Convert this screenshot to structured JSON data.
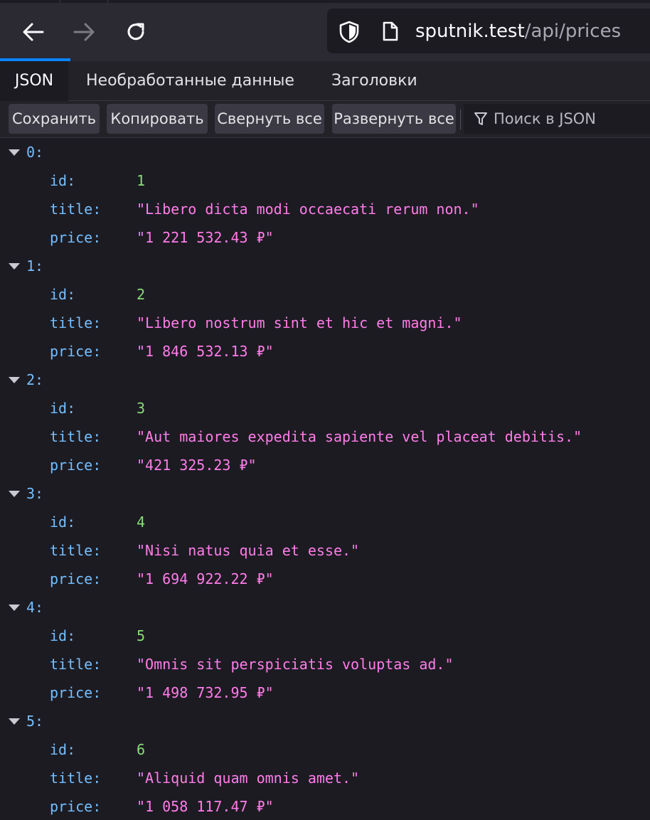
{
  "browser": {
    "url_host": "sputnik.test",
    "url_path": "/api/prices"
  },
  "viewer_tabs": [
    {
      "label": "JSON",
      "active": true
    },
    {
      "label": "Необработанные данные",
      "active": false
    },
    {
      "label": "Заголовки",
      "active": false
    }
  ],
  "toolbar": {
    "save_label": "Сохранить",
    "copy_label": "Копировать",
    "collapse_label": "Свернуть все",
    "expand_label": "Развернуть все",
    "filter_placeholder": "Поиск в JSON"
  },
  "items": [
    {
      "index": "0:",
      "id": "1",
      "title": "\"Libero dicta modi occaecati rerum non.\"",
      "price": "\"1 221 532.43 ₽\""
    },
    {
      "index": "1:",
      "id": "2",
      "title": "\"Libero nostrum sint et hic et magni.\"",
      "price": "\"1 846 532.13 ₽\""
    },
    {
      "index": "2:",
      "id": "3",
      "title": "\"Aut maiores expedita sapiente vel placeat debitis.\"",
      "price": "\"421 325.23 ₽\""
    },
    {
      "index": "3:",
      "id": "4",
      "title": "\"Nisi natus quia et esse.\"",
      "price": "\"1 694 922.22 ₽\""
    },
    {
      "index": "4:",
      "id": "5",
      "title": "\"Omnis sit perspiciatis voluptas ad.\"",
      "price": "\"1 498 732.95 ₽\""
    },
    {
      "index": "5:",
      "id": "6",
      "title": "\"Aliquid quam omnis amet.\"",
      "price": "\"1 058 117.47 ₽\""
    }
  ],
  "keys": {
    "id": "id:",
    "title": "title:",
    "price": "price:"
  },
  "colors": {
    "key": "#75bfff",
    "number": "#86de74",
    "string": "#ff7de9",
    "background": "#1c1b22"
  }
}
